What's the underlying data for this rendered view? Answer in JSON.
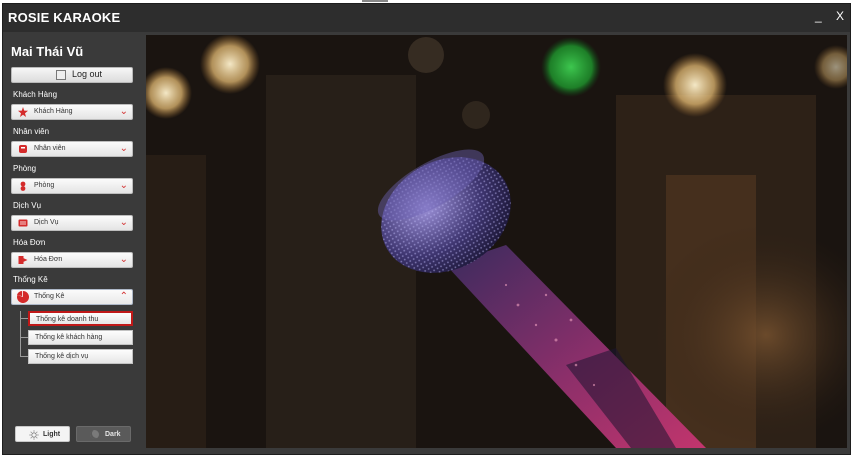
{
  "app": {
    "title": "ROSIE KARAOKE",
    "minimize_label": "_",
    "close_label": "X"
  },
  "sidebar": {
    "user_name": "Mai Thái Vũ",
    "logout_label": "Log out",
    "sections": [
      {
        "heading": "Khách Hàng",
        "combo_label": "Khách Hàng",
        "icon": "customer-icon"
      },
      {
        "heading": "Nhân viên",
        "combo_label": "Nhân viên",
        "icon": "staff-icon"
      },
      {
        "heading": "Phòng",
        "combo_label": "Phòng",
        "icon": "room-icon"
      },
      {
        "heading": "Dịch Vụ",
        "combo_label": "Dịch Vụ",
        "icon": "service-icon"
      },
      {
        "heading": "Hóa Đơn",
        "combo_label": "Hóa Đơn",
        "icon": "invoice-icon"
      },
      {
        "heading": "Thống Kê",
        "combo_label": "Thống Kê",
        "icon": "statistics-icon",
        "expanded": true
      }
    ],
    "stats_submenu": [
      {
        "label": "Thống kê doanh thu",
        "selected": true
      },
      {
        "label": "Thống kê khách hàng"
      },
      {
        "label": "Thống kê dịch vụ"
      }
    ],
    "theme": {
      "light_label": "Light",
      "dark_label": "Dark"
    }
  },
  "colors": {
    "accent": "#d43232",
    "window_bg": "#3a3a3a",
    "titlebar": "#2d2d2d"
  },
  "hero_image": {
    "subject": "microphone-photo"
  }
}
